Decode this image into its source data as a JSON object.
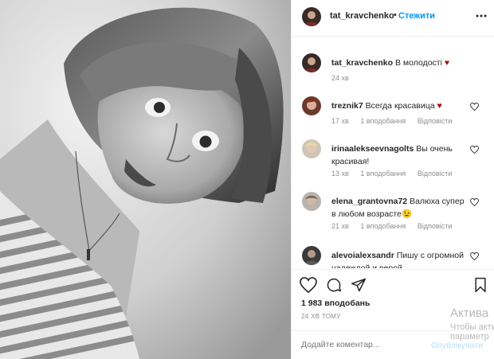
{
  "post": {
    "username": "tat_kravchenko",
    "separator": "•",
    "follow_label": "Стежити",
    "caption": {
      "username": "tat_kravchenko",
      "text": "В молодості",
      "emoji": "♥",
      "time": "24 хв"
    }
  },
  "comments": [
    {
      "username": "treznik7",
      "text": "Всегда красавица",
      "emoji": "♥",
      "time": "17 хв",
      "likes": "1 вподобання",
      "reply": "Відповісти"
    },
    {
      "username": "irinaalekseevnagolts",
      "text": "Вы очень красивая!",
      "emoji": "",
      "time": "13 хв",
      "likes": "1 вподобання",
      "reply": "Відповісти"
    },
    {
      "username": "elena_grantovna72",
      "text": "Валюха супер в любом возрасте",
      "emoji": "😉",
      "time": "21 хв",
      "likes": "1 вподобання",
      "reply": "Відповісти"
    },
    {
      "username": "alevoialexsandr",
      "text": "Пишу с огромной надеждой и верой.",
      "emoji": "",
      "time": "",
      "likes": "",
      "reply": ""
    }
  ],
  "stats": {
    "likes_count": "1 983 вподобань",
    "time_ago": "24 ХВ ТОМУ"
  },
  "add_comment": {
    "placeholder": "Додайте коментар...",
    "post_label": "Опублікувати"
  },
  "watermark": {
    "line1": "Актива",
    "line2": "Чтобы акти",
    "line3": "параметр"
  },
  "icons": {
    "more": "more-dots-icon",
    "like": "heart-outline-icon",
    "comment": "comment-bubble-icon",
    "share": "paper-plane-icon",
    "save": "bookmark-icon"
  },
  "colors": {
    "link_blue": "#0095f6",
    "post_disabled": "#b2dffc",
    "heart_red": "#a01010",
    "muted_text": "#8e8e8e"
  }
}
